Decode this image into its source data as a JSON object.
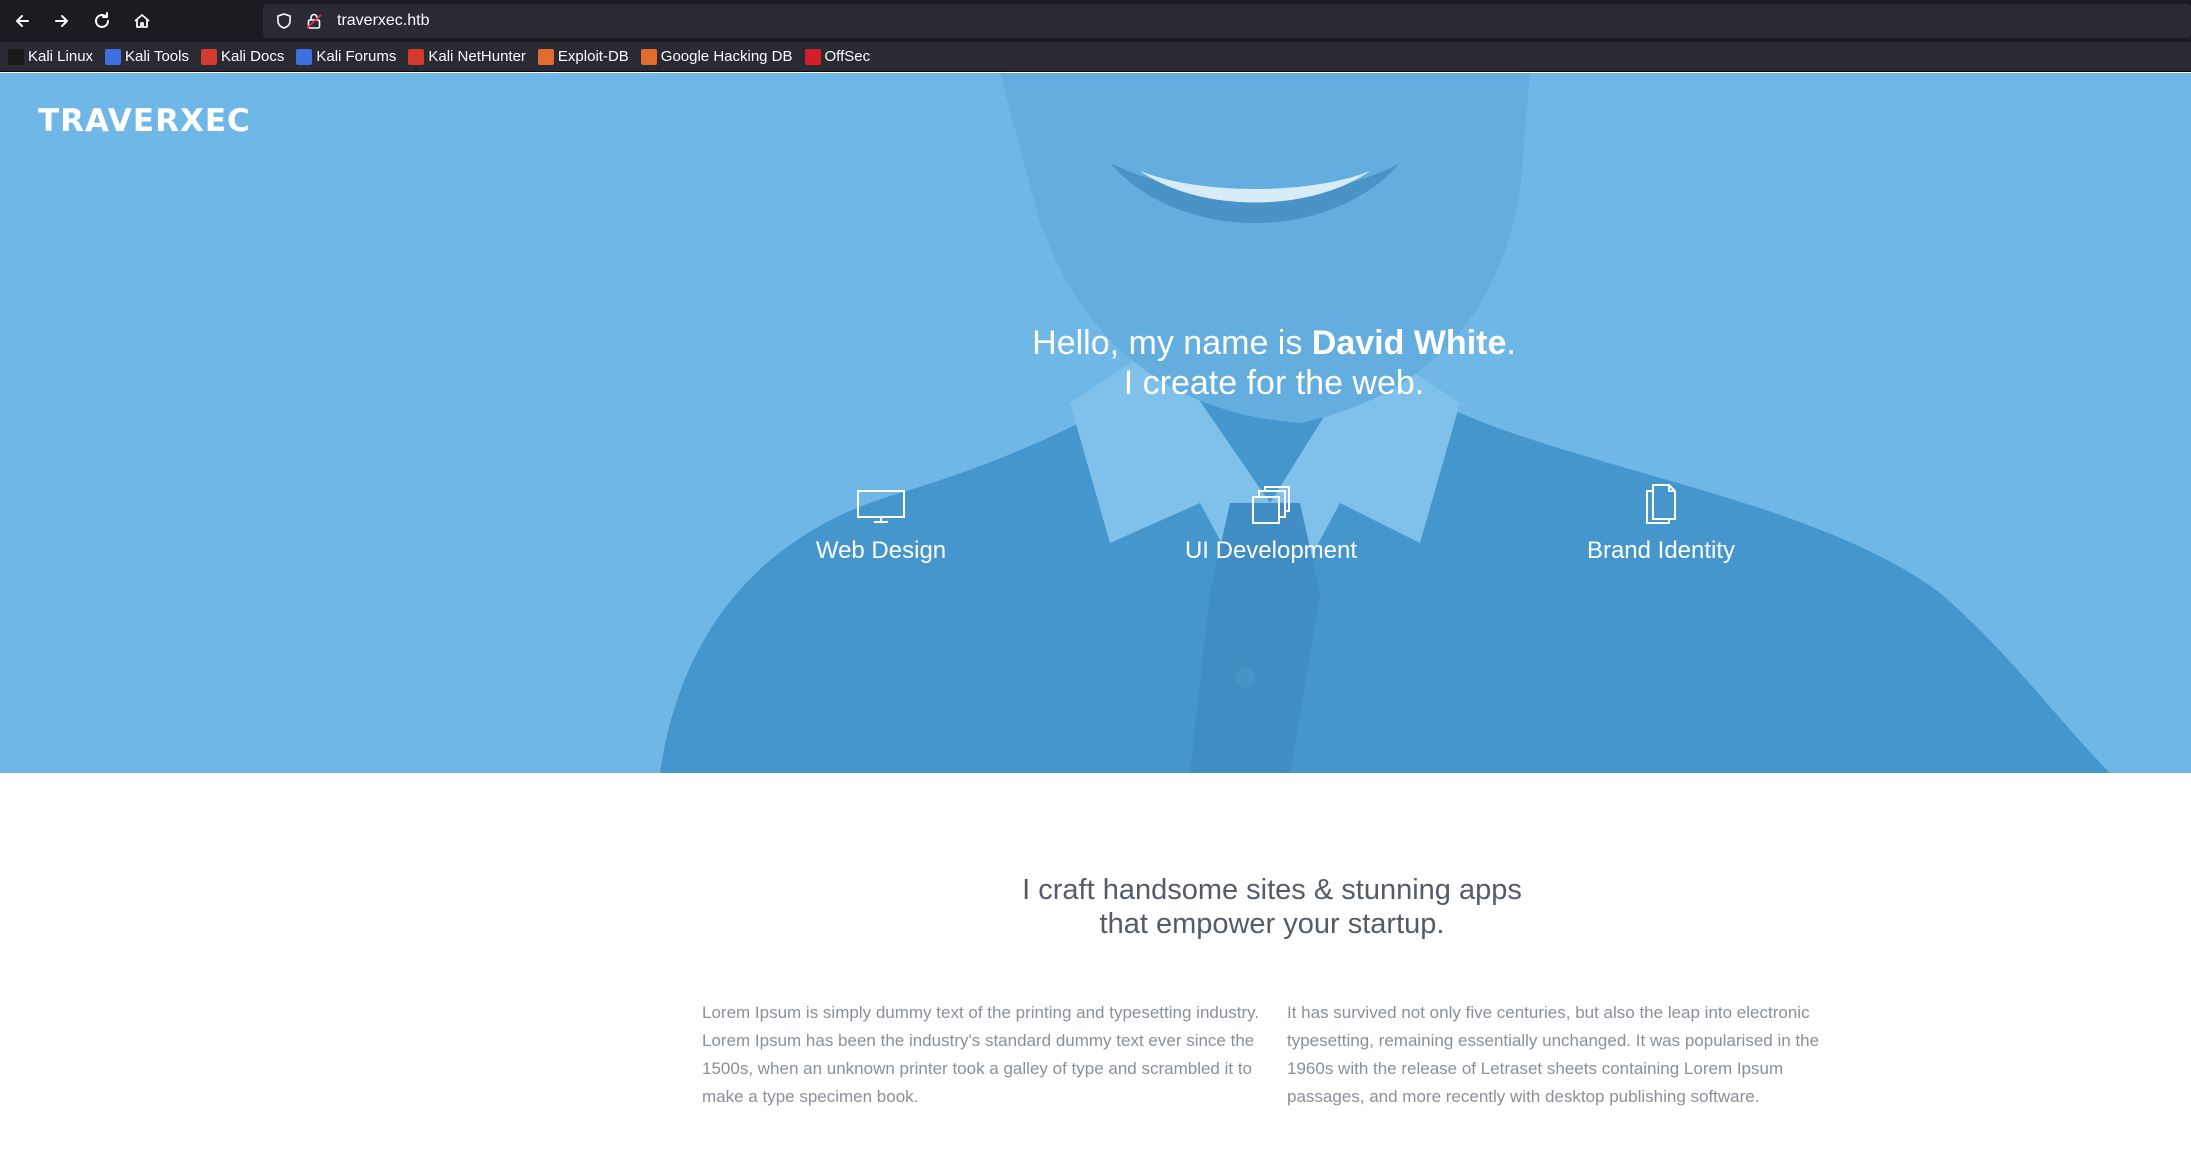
{
  "browser": {
    "url": "traverxec.htb",
    "nav": {
      "back_icon": "arrow-left-icon",
      "forward_icon": "arrow-right-icon",
      "reload_icon": "reload-icon",
      "home_icon": "home-icon"
    },
    "bookmarks": [
      {
        "label": "Kali Linux",
        "color": "#1b1b1b"
      },
      {
        "label": "Kali Tools",
        "color": "#3d6fe0"
      },
      {
        "label": "Kali Docs",
        "color": "#d23b2e"
      },
      {
        "label": "Kali Forums",
        "color": "#3d6fe0"
      },
      {
        "label": "Kali NetHunter",
        "color": "#d23b2e"
      },
      {
        "label": "Exploit-DB",
        "color": "#e06c2d"
      },
      {
        "label": "Google Hacking DB",
        "color": "#e06c2d"
      },
      {
        "label": "OffSec",
        "color": "#d21f2b"
      }
    ]
  },
  "hero": {
    "brand": "TRAVERXEC",
    "headline_prefix": "Hello, my name is ",
    "headline_name": "David White",
    "headline_suffix": ".",
    "headline_line2": "I create for the web.",
    "services": [
      {
        "label": "Web Design",
        "icon": "monitor-icon"
      },
      {
        "label": "UI Development",
        "icon": "layers-icon"
      },
      {
        "label": "Brand Identity",
        "icon": "documents-icon"
      }
    ],
    "overlay_color": "#6fb7e6"
  },
  "content": {
    "tagline_line1": "I craft handsome sites & stunning apps",
    "tagline_line2": "that empower your startup.",
    "col_left": "Lorem Ipsum is simply dummy text of the printing and typesetting industry. Lorem Ipsum has been the industry's standard dummy text ever since the 1500s, when an unknown printer took a galley of type and scrambled it to make a type specimen book.",
    "col_right": "It has survived not only five centuries, but also the leap into electronic typesetting, remaining essentially unchanged. It was popularised in the 1960s with the release of Letraset sheets containing Lorem Ipsum passages, and more recently with desktop publishing software."
  }
}
